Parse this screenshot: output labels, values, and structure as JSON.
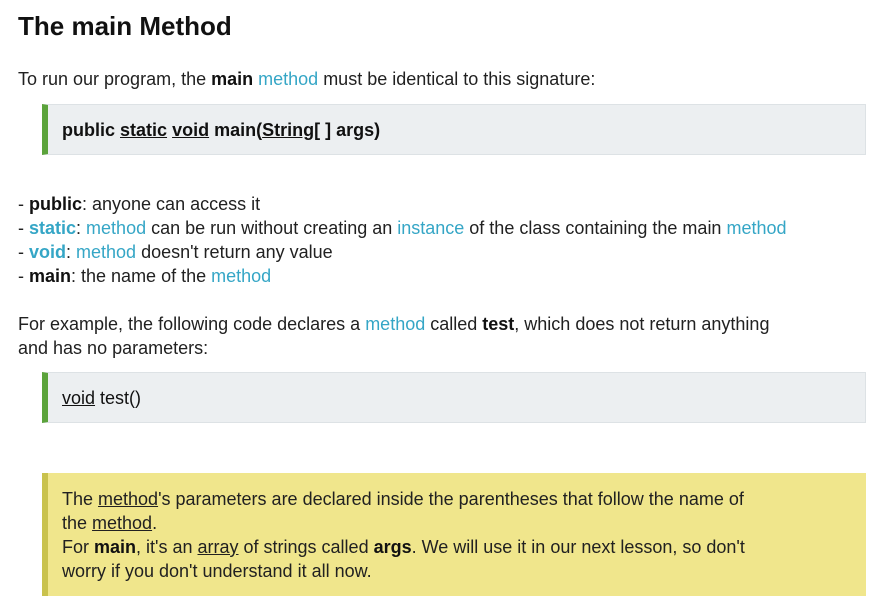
{
  "title": "The main Method",
  "intro": {
    "before": "To run our program, the ",
    "main": "main",
    "method": "method",
    "after": " must be identical to this signature:"
  },
  "signature": {
    "public": "public",
    "static": "static",
    "void": "void",
    "main": "main(",
    "string": "String",
    "rest": "[ ] args)"
  },
  "bullets": [
    {
      "dash": "- ",
      "term": "public",
      "text": ": anyone can access it"
    },
    {
      "dash": "- ",
      "term": "static",
      "sep": ": ",
      "link1": "method",
      "mid": " can be run without creating an ",
      "link2": "instance",
      "mid2": " of the class containing the main ",
      "link3": "method"
    },
    {
      "dash": "- ",
      "term": "void",
      "sep": ": ",
      "link1": "method",
      "rest": " doesn't return any value"
    },
    {
      "dash": "- ",
      "term": "main",
      "text": ": the name of the ",
      "link1": "method"
    }
  ],
  "example": {
    "line1_before": "For example, the following code declares a ",
    "method": "method",
    "called": " called ",
    "test": "test",
    "line1_after": ", which does not return anything",
    "line2": "and has no parameters:"
  },
  "example_code": {
    "void": "void",
    "rest": " test()"
  },
  "note": {
    "l1_before": "The ",
    "l1_method": "method",
    "l1_after": "'s parameters are declared inside the parentheses that follow the name of",
    "l2_before": "the ",
    "l2_method": "method",
    "l2_after": ".",
    "l3_before": "For ",
    "l3_main": "main",
    "l3_mid": ", it's an ",
    "l3_array": "array",
    "l3_mid2": " of strings called ",
    "l3_args": "args",
    "l3_after": ". We will use it in our next lesson, so don't",
    "l4": "worry if you don't understand it all now."
  },
  "colors": {
    "link": "#35a6c6",
    "code_bar": "#5ba33b",
    "code_bg": "#eceff1",
    "note_bg": "#f0e68c",
    "note_bar": "#c9c24d"
  }
}
